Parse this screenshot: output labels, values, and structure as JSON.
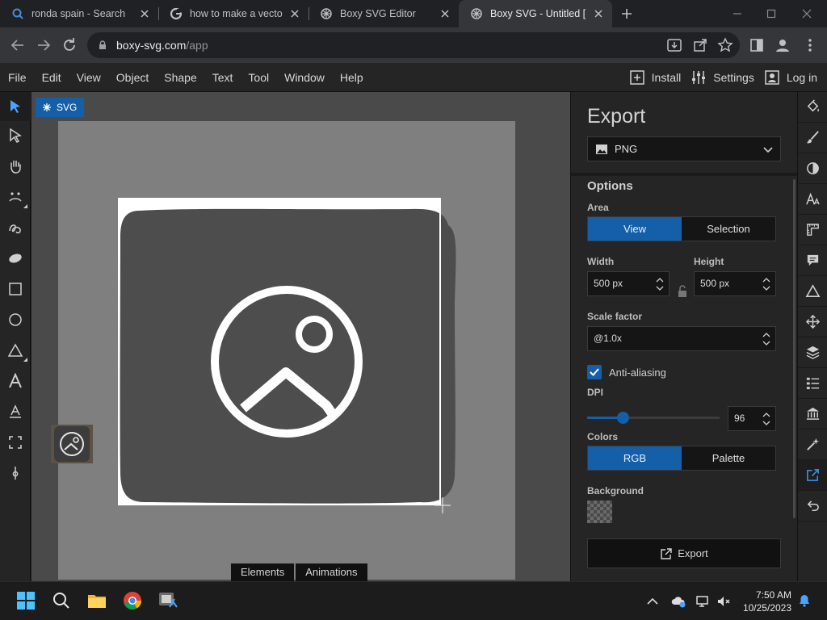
{
  "browser": {
    "tabs": [
      {
        "title": "ronda spain - Search",
        "favicon": "search-icon",
        "active": false
      },
      {
        "title": "how to make a vector i",
        "favicon": "google-icon",
        "active": false
      },
      {
        "title": "Boxy SVG Editor",
        "favicon": "boxy-svg-icon",
        "active": false
      },
      {
        "title": "Boxy SVG - Untitled [E",
        "favicon": "boxy-svg-icon",
        "active": true
      }
    ],
    "url_host": "boxy-svg.com",
    "url_path": "/app"
  },
  "menubar": {
    "items": [
      "File",
      "Edit",
      "View",
      "Object",
      "Shape",
      "Text",
      "Tool",
      "Window",
      "Help"
    ],
    "install_label": "Install",
    "settings_label": "Settings",
    "login_label": "Log in"
  },
  "canvas": {
    "badge_label": "SVG",
    "bottom_tabs": [
      "Elements",
      "Animations"
    ]
  },
  "export_panel": {
    "title": "Export",
    "format": "PNG",
    "options_title": "Options",
    "area_label": "Area",
    "area_options": [
      "View",
      "Selection"
    ],
    "area_selected": "View",
    "width_label": "Width",
    "width_value": "500 px",
    "height_label": "Height",
    "height_value": "500 px",
    "scale_label": "Scale factor",
    "scale_value": "@1.0x",
    "antialias_label": "Anti-aliasing",
    "antialias_checked": true,
    "dpi_label": "DPI",
    "dpi_value": "96",
    "dpi_slider_fraction": 0.27,
    "colors_label": "Colors",
    "color_options": [
      "RGB",
      "Palette"
    ],
    "color_selected": "RGB",
    "background_label": "Background",
    "export_button": "Export"
  },
  "taskbar": {
    "time": "7:50 AM",
    "date": "10/25/2023"
  },
  "colors": {
    "accent": "#155fa8",
    "panel_bg": "#252526",
    "canvas_bg": "#4a4a4a",
    "artboard_bg": "#7f7f7f",
    "shape_fill": "#4d4d4d"
  }
}
